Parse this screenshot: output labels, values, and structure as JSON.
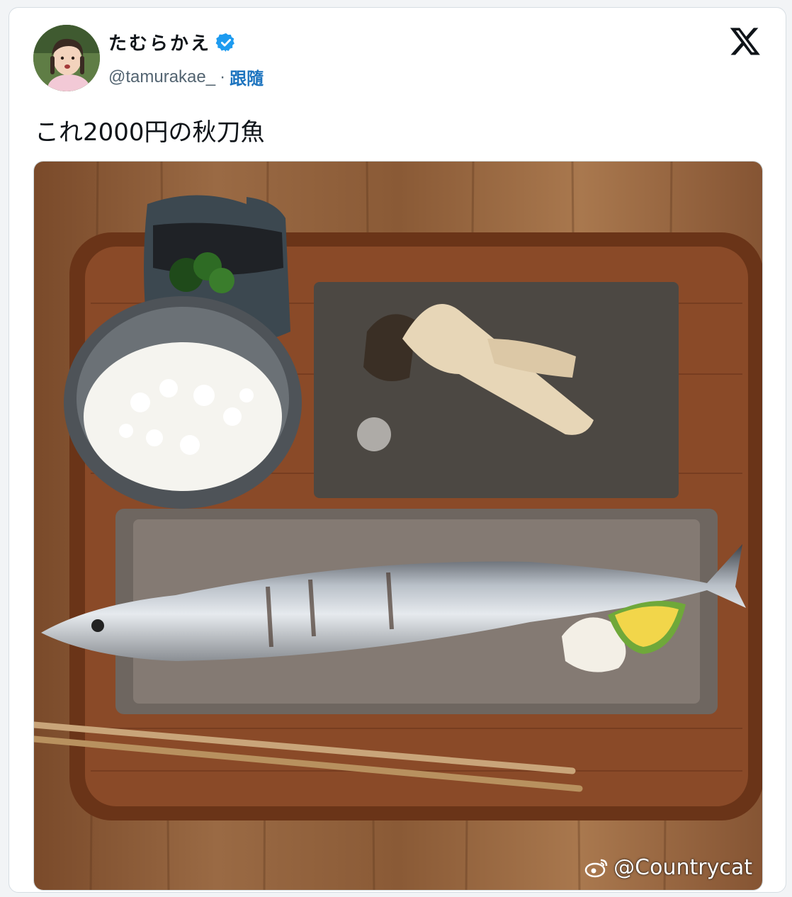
{
  "tweet": {
    "display_name": "たむらかえ",
    "handle": "@tamurakae_",
    "separator": "·",
    "follow_label": "跟隨",
    "text": "これ2000円の秋刀魚"
  },
  "colors": {
    "accent": "#1d9bf0",
    "follow": "#1d74bf",
    "text": "#0f1419",
    "secondary": "#536471"
  },
  "icons": {
    "verified": "verified-badge-icon",
    "platform": "x-logo-icon",
    "watermark": "weibo-icon"
  },
  "watermark": {
    "text": "@Countrycat"
  }
}
